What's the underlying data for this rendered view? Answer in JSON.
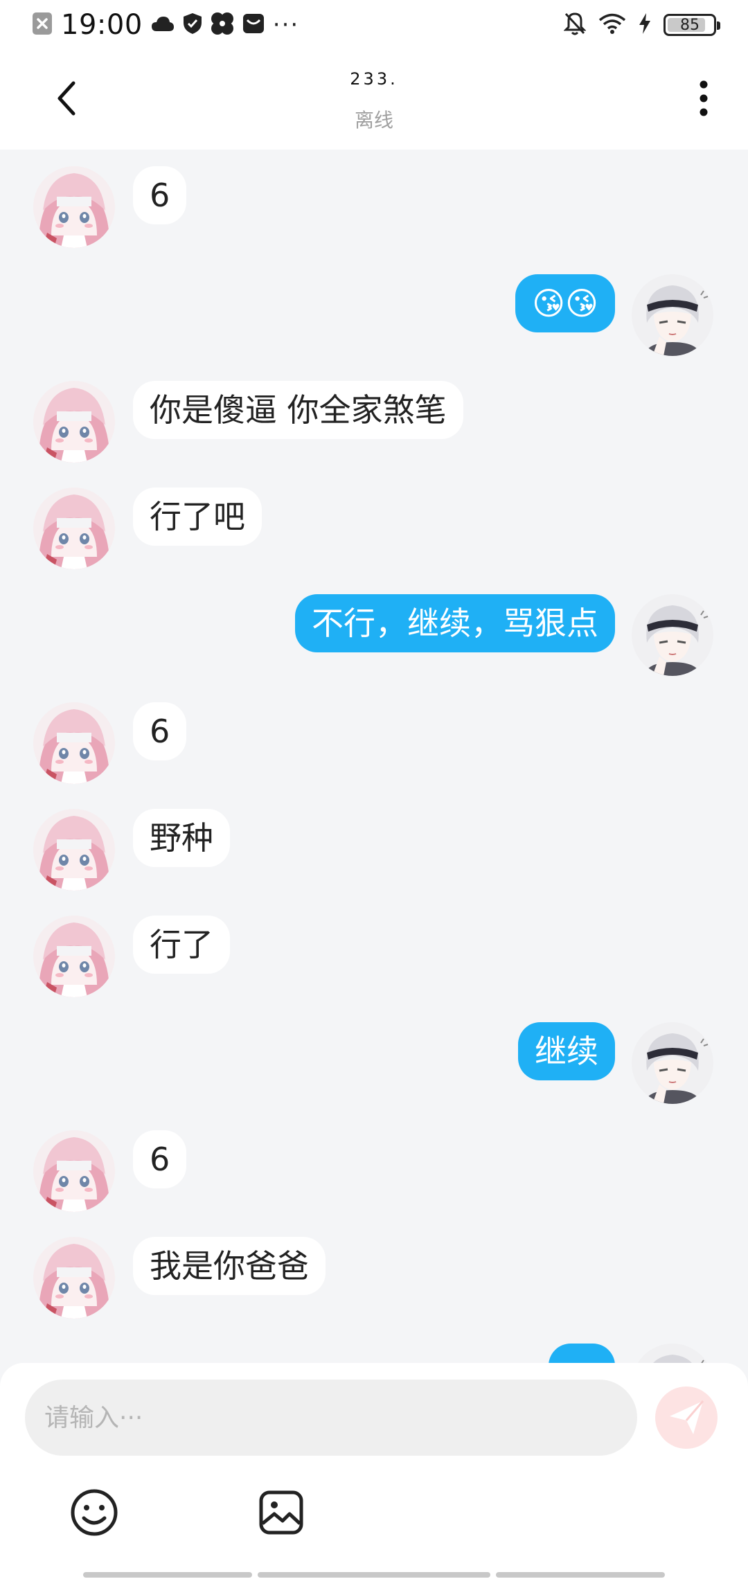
{
  "status_bar": {
    "time": "19:00",
    "overflow": "···",
    "battery_level": "85",
    "battery_fraction": 0.85,
    "icons": [
      "close-notification-icon",
      "cloud-icon",
      "shield-icon",
      "pinwheel-icon",
      "inbox-icon",
      "bell-off-icon",
      "wifi-icon",
      "charging-bolt-icon",
      "battery-icon"
    ]
  },
  "header": {
    "title": "233.",
    "status": "离线",
    "back_icon": "back-chevron-icon",
    "more_icon": "more-vertical-icon"
  },
  "messages": [
    {
      "dir": "in",
      "text": "6"
    },
    {
      "dir": "out",
      "text": "😘😘"
    },
    {
      "dir": "in",
      "text": "你是傻逼 你全家煞笔"
    },
    {
      "dir": "in",
      "text": "行了吧"
    },
    {
      "dir": "out",
      "text": "不行，继续，骂狠点"
    },
    {
      "dir": "in",
      "text": "6"
    },
    {
      "dir": "in",
      "text": "野种"
    },
    {
      "dir": "in",
      "text": "行了"
    },
    {
      "dir": "out",
      "text": "继续"
    },
    {
      "dir": "in",
      "text": "6"
    },
    {
      "dir": "in",
      "text": "我是你爸爸"
    },
    {
      "dir": "out",
      "text": ""
    }
  ],
  "composer": {
    "placeholder": "请输入···",
    "value": "",
    "send_icon": "send-icon",
    "tools": [
      "emoji-icon",
      "image-icon"
    ]
  },
  "colors": {
    "accent": "#1fb0f5",
    "background": "#f4f5f7",
    "bubble_in": "#ffffff",
    "send_disabled": "#fde3e3"
  }
}
